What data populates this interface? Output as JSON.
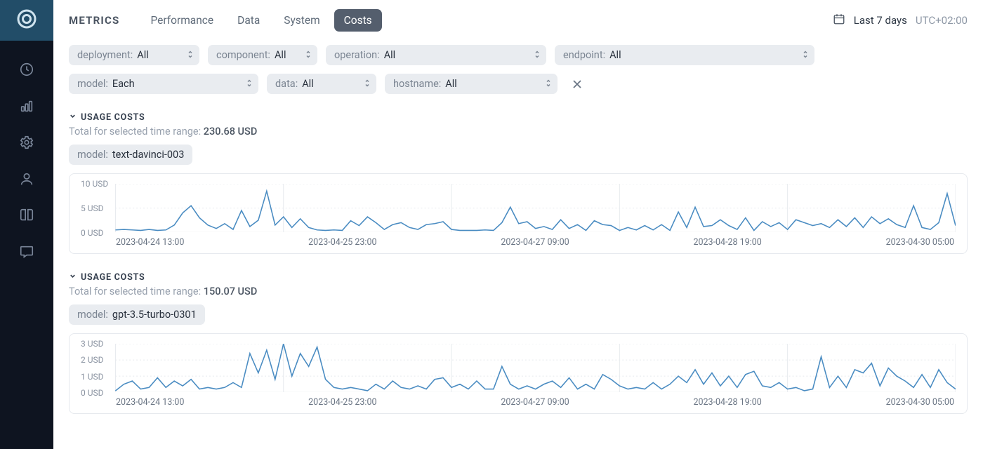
{
  "header": {
    "title": "METRICS",
    "tabs": [
      "Performance",
      "Data",
      "System",
      "Costs"
    ],
    "active_tab": "Costs",
    "time_range": "Last 7 days",
    "timezone": "UTC+02:00"
  },
  "filters": {
    "row1": [
      {
        "label": "deployment:",
        "value": "All"
      },
      {
        "label": "component:",
        "value": "All"
      },
      {
        "label": "operation:",
        "value": "All"
      },
      {
        "label": "endpoint:",
        "value": "All"
      }
    ],
    "row2": [
      {
        "label": "model:",
        "value": "Each"
      },
      {
        "label": "data:",
        "value": "All"
      },
      {
        "label": "hostname:",
        "value": "All"
      }
    ]
  },
  "sections": [
    {
      "title": "USAGE COSTS",
      "subtitle_prefix": "Total for selected time range: ",
      "subtitle_value": "230.68 USD",
      "model_label": "model:",
      "model_value": "text-davinci-003"
    },
    {
      "title": "USAGE COSTS",
      "subtitle_prefix": "Total for selected time range: ",
      "subtitle_value": "150.07 USD",
      "model_label": "model:",
      "model_value": "gpt-3.5-turbo-0301"
    }
  ],
  "chart_data": [
    {
      "type": "line",
      "title": "Usage Costs — text-davinci-003",
      "ylabel": "USD",
      "ylim": [
        0,
        10
      ],
      "yticks": [
        0,
        5,
        10
      ],
      "ytick_labels": [
        "0 USD",
        "5 USD",
        "10 USD"
      ],
      "x_range_labels": [
        "2023-04-24 13:00",
        "2023-04-25 23:00",
        "2023-04-27 09:00",
        "2023-04-28 19:00",
        "2023-04-30 05:00"
      ],
      "x": [
        0,
        1,
        2,
        3,
        4,
        5,
        6,
        7,
        8,
        9,
        10,
        11,
        12,
        13,
        14,
        15,
        16,
        17,
        18,
        19,
        20,
        21,
        22,
        23,
        24,
        25,
        26,
        27,
        28,
        29,
        30,
        31,
        32,
        33,
        34,
        35,
        36,
        37,
        38,
        39,
        40,
        41,
        42,
        43,
        44,
        45,
        46,
        47,
        48,
        49,
        50,
        51,
        52,
        53,
        54,
        55,
        56,
        57,
        58,
        59,
        60,
        61,
        62,
        63,
        64,
        65,
        66,
        67,
        68,
        69,
        70,
        71,
        72,
        73,
        74,
        75,
        76,
        77,
        78,
        79,
        80,
        81,
        82,
        83,
        84,
        85,
        86,
        87,
        88,
        89,
        90,
        91,
        92,
        93,
        94,
        95,
        96,
        97,
        98,
        99,
        100
      ],
      "values": [
        0.5,
        0.6,
        0.5,
        0.4,
        0.6,
        0.4,
        0.5,
        1.5,
        4.0,
        5.5,
        3.0,
        1.5,
        0.8,
        1.8,
        0.6,
        4.5,
        1.2,
        2.5,
        8.5,
        1.5,
        3.2,
        1.0,
        2.8,
        1.0,
        0.5,
        0.4,
        0.5,
        0.4,
        2.4,
        1.4,
        3.2,
        2.0,
        0.6,
        1.6,
        2.0,
        1.0,
        0.6,
        1.6,
        1.8,
        2.2,
        0.6,
        0.4,
        0.4,
        0.4,
        0.5,
        0.4,
        2.0,
        5.2,
        1.8,
        2.2,
        0.8,
        1.2,
        0.6,
        2.6,
        0.8,
        1.6,
        0.4,
        2.4,
        1.6,
        1.4,
        0.4,
        1.0,
        0.5,
        1.4,
        0.5,
        1.6,
        0.4,
        4.2,
        1.0,
        5.2,
        1.2,
        1.4,
        2.6,
        1.4,
        0.6,
        3.0,
        0.4,
        2.2,
        1.2,
        2.0,
        0.6,
        2.6,
        2.0,
        1.4,
        1.8,
        1.0,
        2.6,
        1.2,
        3.0,
        1.0,
        3.2,
        1.8,
        2.8,
        1.6,
        1.0,
        5.5,
        1.0,
        0.6,
        2.0,
        8.0,
        1.4
      ]
    },
    {
      "type": "line",
      "title": "Usage Costs — gpt-3.5-turbo-0301",
      "ylabel": "USD",
      "ylim": [
        0,
        3
      ],
      "yticks": [
        0,
        1,
        2,
        3
      ],
      "ytick_labels": [
        "0 USD",
        "1 USD",
        "2 USD",
        "3 USD"
      ],
      "x_range_labels": [
        "2023-04-24 13:00",
        "2023-04-25 23:00",
        "2023-04-27 09:00",
        "2023-04-28 19:00",
        "2023-04-30 05:00"
      ],
      "x": [
        0,
        1,
        2,
        3,
        4,
        5,
        6,
        7,
        8,
        9,
        10,
        11,
        12,
        13,
        14,
        15,
        16,
        17,
        18,
        19,
        20,
        21,
        22,
        23,
        24,
        25,
        26,
        27,
        28,
        29,
        30,
        31,
        32,
        33,
        34,
        35,
        36,
        37,
        38,
        39,
        40,
        41,
        42,
        43,
        44,
        45,
        46,
        47,
        48,
        49,
        50,
        51,
        52,
        53,
        54,
        55,
        56,
        57,
        58,
        59,
        60,
        61,
        62,
        63,
        64,
        65,
        66,
        67,
        68,
        69,
        70,
        71,
        72,
        73,
        74,
        75,
        76,
        77,
        78,
        79,
        80,
        81,
        82,
        83,
        84,
        85,
        86,
        87,
        88,
        89,
        90,
        91,
        92,
        93,
        94,
        95,
        96,
        97,
        98,
        99,
        100
      ],
      "values": [
        0.1,
        0.5,
        0.7,
        0.2,
        0.3,
        0.9,
        0.3,
        0.7,
        0.4,
        0.8,
        0.2,
        0.3,
        0.2,
        0.3,
        0.6,
        0.3,
        2.4,
        1.2,
        2.6,
        0.8,
        3.0,
        1.0,
        2.4,
        1.6,
        2.8,
        0.8,
        0.3,
        0.2,
        0.3,
        0.2,
        0.1,
        0.5,
        0.2,
        0.7,
        0.3,
        0.2,
        0.4,
        0.2,
        0.8,
        0.9,
        0.3,
        0.5,
        0.2,
        0.7,
        0.2,
        0.2,
        1.6,
        0.5,
        0.2,
        0.4,
        0.2,
        0.5,
        0.7,
        0.3,
        0.9,
        0.2,
        0.5,
        0.2,
        1.1,
        0.8,
        0.4,
        0.2,
        0.3,
        0.2,
        0.6,
        0.2,
        0.5,
        1.0,
        0.6,
        1.4,
        0.5,
        1.2,
        0.4,
        1.0,
        0.3,
        1.1,
        1.3,
        0.4,
        0.3,
        0.6,
        0.2,
        0.3,
        0.1,
        0.2,
        2.2,
        0.3,
        1.0,
        0.3,
        1.4,
        1.2,
        1.8,
        0.4,
        1.5,
        1.0,
        0.7,
        0.3,
        1.1,
        0.3,
        1.4,
        0.6,
        0.2
      ]
    }
  ],
  "colors": {
    "line": "#4a8cc2",
    "grid": "#e7eaee"
  },
  "sidebar_items": [
    "clock",
    "bar-chart",
    "gear",
    "user",
    "book",
    "chat"
  ]
}
